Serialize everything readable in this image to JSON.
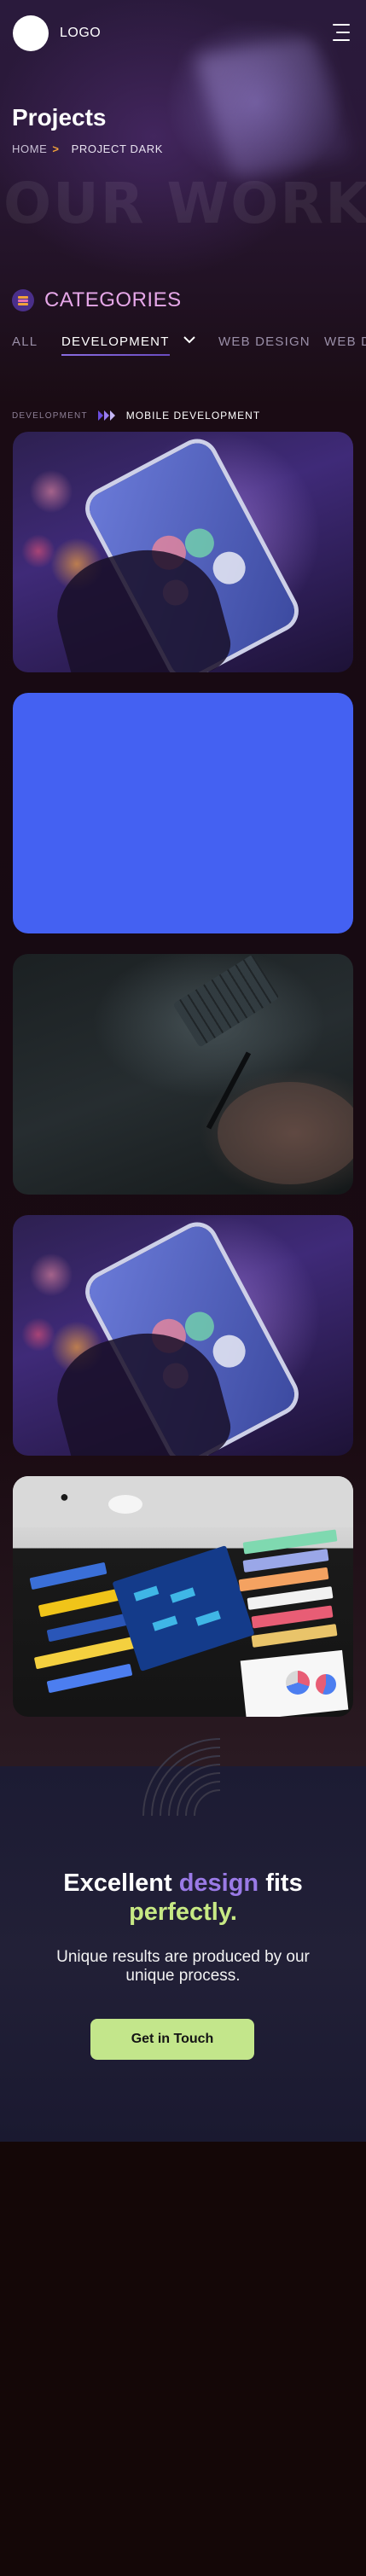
{
  "header": {
    "logo_text": "LOGO",
    "menu_icon": "hamburger-menu-icon"
  },
  "hero": {
    "title": "Projects",
    "breadcrumb": {
      "home": "HOME",
      "separator": ">",
      "current": "PROJECT DARK"
    },
    "watermark": "OUR WORK"
  },
  "categories": {
    "icon": "categories-icon",
    "title": "CATEGORIES",
    "tabs": [
      "ALL",
      "DEVELOPMENT",
      "WEB DESIGN",
      "WEB DESIGN"
    ],
    "active_tab": "DEVELOPMENT",
    "chevron_icon": "chevron-down-icon"
  },
  "projects": {
    "breadcrumb": {
      "parent": "DEVELOPMENT",
      "current": "MOBILE DEVELOPMENT"
    },
    "items": [
      {
        "image": "phone-bokeh-photo"
      },
      {
        "image": "solid-blue-placeholder",
        "color": "#4461f2"
      },
      {
        "image": "laptop-stylus-photo"
      },
      {
        "image": "phone-bokeh-photo"
      },
      {
        "image": "design-swatches-photo"
      }
    ]
  },
  "cta": {
    "title_part1": "Excellent ",
    "title_accent": "design",
    "title_part2": " fits",
    "title_part3": "perfectly.",
    "subtitle": "Unique results are produced by our unique process.",
    "button_label": "Get in Touch"
  },
  "colors": {
    "accent_purple": "#9a7ae6",
    "accent_green": "#c7e984",
    "accent_pink": "#e6a7e8",
    "arrow_orange": "#f2a23a",
    "button_bg": "#c3e68b",
    "blue_card": "#4461f2",
    "cta_bg": "#1c1b33",
    "footer_bg": "#140707"
  }
}
